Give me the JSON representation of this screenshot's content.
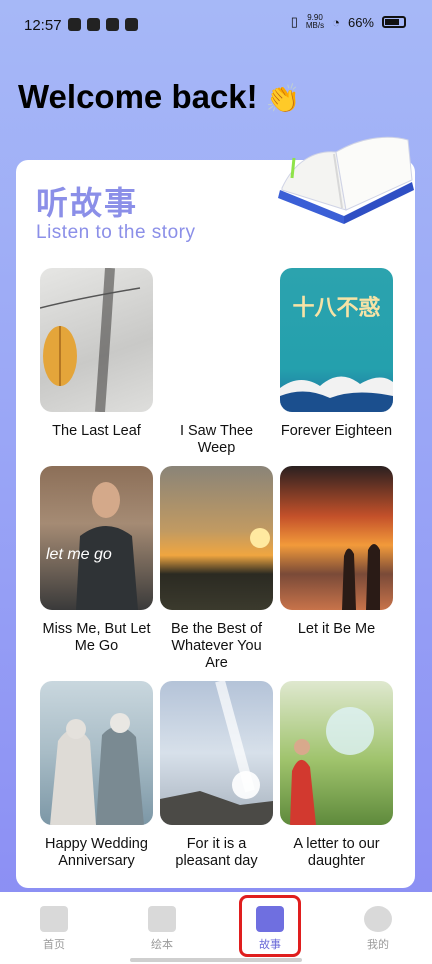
{
  "status": {
    "time": "12:57",
    "net_speed_value": "9.90",
    "net_speed_unit": "MB/s",
    "battery": "66%"
  },
  "welcome": {
    "text": "Welcome back!",
    "emoji": "👏"
  },
  "section": {
    "title": "听故事",
    "subtitle": "Listen to the story"
  },
  "stories": [
    {
      "title": "The Last Leaf"
    },
    {
      "title": "I Saw Thee Weep"
    },
    {
      "title": "Forever Eighteen",
      "cover_text": "十八不惑"
    },
    {
      "title": "Miss Me, But Let Me Go",
      "cover_text": "let me go"
    },
    {
      "title": "Be the Best of Whatever You Are"
    },
    {
      "title": "Let it Be Me"
    },
    {
      "title": "Happy Wedding Anniversary"
    },
    {
      "title": "For it is a pleasant day"
    },
    {
      "title": "A letter to our daughter"
    }
  ],
  "nav": {
    "items": [
      {
        "label": "首页",
        "icon": "home-icon"
      },
      {
        "label": "绘本",
        "icon": "picture-book-icon"
      },
      {
        "label": "故事",
        "icon": "story-book-icon",
        "active": true
      },
      {
        "label": "我的",
        "icon": "profile-icon"
      }
    ]
  },
  "colors": {
    "accent": "#8b8fe8",
    "highlight": "#e01e1e"
  }
}
